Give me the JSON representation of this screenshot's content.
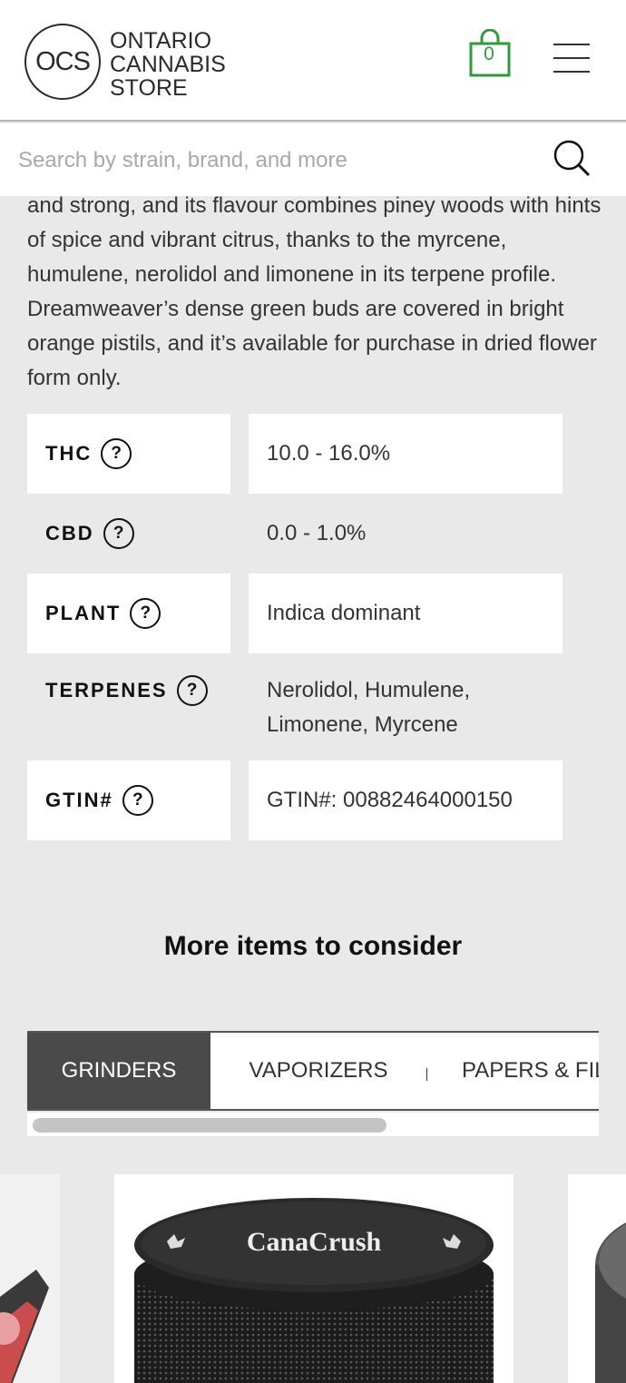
{
  "header": {
    "logo_mark": "OCS",
    "logo_lines": [
      "ONTARIO",
      "CANNABIS",
      "STORE"
    ],
    "cart_count": "0",
    "brand_color": "#2f9b3a"
  },
  "search": {
    "placeholder": "Search by strain, brand, and more"
  },
  "description": "and strong, and its flavour combines piney woods with hints of spice and vibrant citrus, thanks to the myrcene, humulene, nerolidol and limonene in its terpene profile. Dreamweaver’s dense green buds are covered in bright orange pistils, and it’s available for purchase in dried flower form only.",
  "specs": [
    {
      "label": "THC",
      "value": "10.0 - 16.0%"
    },
    {
      "label": "CBD",
      "value": "0.0 - 1.0%"
    },
    {
      "label": "PLANT",
      "value": "Indica dominant"
    },
    {
      "label": "TERPENES",
      "value": "Nerolidol, Humulene, Limonene, Myrcene"
    },
    {
      "label": "GTIN#",
      "value": "GTIN#: 00882464000150"
    }
  ],
  "help_symbol": "?",
  "more_items": {
    "title": "More items to consider",
    "tabs": [
      "GRINDERS",
      "VAPORIZERS",
      "PAPERS & FIL"
    ],
    "active_tab": "GRINDERS"
  },
  "product_brand": "CanaCrush"
}
